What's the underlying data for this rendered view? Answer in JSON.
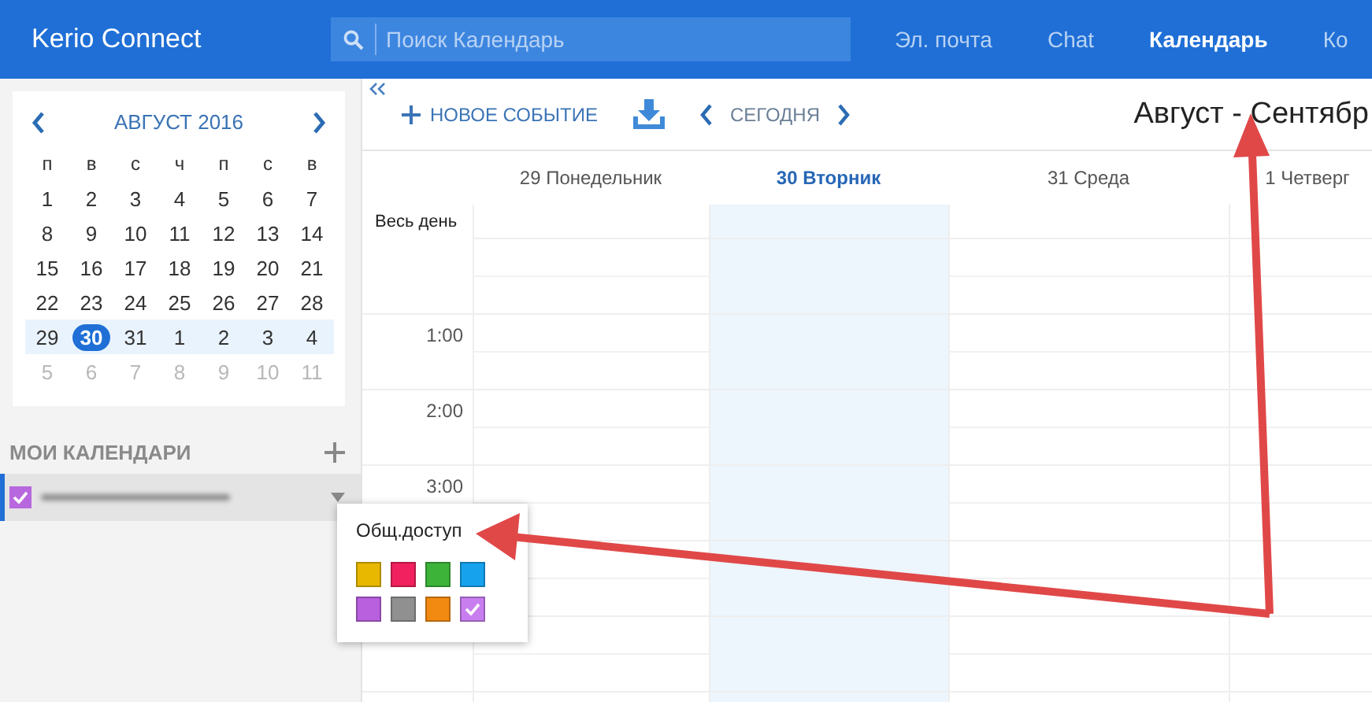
{
  "header": {
    "app_title": "Kerio Connect",
    "search": {
      "placeholder": "Поиск Календарь"
    },
    "nav": [
      {
        "label": "Эл. почта",
        "selected": false
      },
      {
        "label": "Chat",
        "selected": false
      },
      {
        "label": "Календарь",
        "selected": true
      },
      {
        "label": "Ко",
        "selected": false
      }
    ]
  },
  "mini_calendar": {
    "month": "АВГУСТ 2016",
    "weekdays": [
      "п",
      "в",
      "с",
      "ч",
      "п",
      "с",
      "в"
    ],
    "weeks": [
      {
        "current": false,
        "days": [
          {
            "label": "1",
            "muted": false,
            "selected": false
          },
          {
            "label": "2",
            "muted": false,
            "selected": false
          },
          {
            "label": "3",
            "muted": false,
            "selected": false
          },
          {
            "label": "4",
            "muted": false,
            "selected": false
          },
          {
            "label": "5",
            "muted": false,
            "selected": false
          },
          {
            "label": "6",
            "muted": false,
            "selected": false
          },
          {
            "label": "7",
            "muted": false,
            "selected": false
          }
        ]
      },
      {
        "current": false,
        "days": [
          {
            "label": "8",
            "muted": false,
            "selected": false
          },
          {
            "label": "9",
            "muted": false,
            "selected": false
          },
          {
            "label": "10",
            "muted": false,
            "selected": false
          },
          {
            "label": "11",
            "muted": false,
            "selected": false
          },
          {
            "label": "12",
            "muted": false,
            "selected": false
          },
          {
            "label": "13",
            "muted": false,
            "selected": false
          },
          {
            "label": "14",
            "muted": false,
            "selected": false
          }
        ]
      },
      {
        "current": false,
        "days": [
          {
            "label": "15",
            "muted": false,
            "selected": false
          },
          {
            "label": "16",
            "muted": false,
            "selected": false
          },
          {
            "label": "17",
            "muted": false,
            "selected": false
          },
          {
            "label": "18",
            "muted": false,
            "selected": false
          },
          {
            "label": "19",
            "muted": false,
            "selected": false
          },
          {
            "label": "20",
            "muted": false,
            "selected": false
          },
          {
            "label": "21",
            "muted": false,
            "selected": false
          }
        ]
      },
      {
        "current": false,
        "days": [
          {
            "label": "22",
            "muted": false,
            "selected": false
          },
          {
            "label": "23",
            "muted": false,
            "selected": false
          },
          {
            "label": "24",
            "muted": false,
            "selected": false
          },
          {
            "label": "25",
            "muted": false,
            "selected": false
          },
          {
            "label": "26",
            "muted": false,
            "selected": false
          },
          {
            "label": "27",
            "muted": false,
            "selected": false
          },
          {
            "label": "28",
            "muted": false,
            "selected": false
          }
        ]
      },
      {
        "current": true,
        "days": [
          {
            "label": "29",
            "muted": false,
            "selected": false
          },
          {
            "label": "30",
            "muted": false,
            "selected": true
          },
          {
            "label": "31",
            "muted": false,
            "selected": false
          },
          {
            "label": "1",
            "muted": false,
            "selected": false
          },
          {
            "label": "2",
            "muted": false,
            "selected": false
          },
          {
            "label": "3",
            "muted": false,
            "selected": false
          },
          {
            "label": "4",
            "muted": false,
            "selected": false
          }
        ]
      },
      {
        "current": false,
        "days": [
          {
            "label": "5",
            "muted": true,
            "selected": false
          },
          {
            "label": "6",
            "muted": true,
            "selected": false
          },
          {
            "label": "7",
            "muted": true,
            "selected": false
          },
          {
            "label": "8",
            "muted": true,
            "selected": false
          },
          {
            "label": "9",
            "muted": true,
            "selected": false
          },
          {
            "label": "10",
            "muted": true,
            "selected": false
          },
          {
            "label": "11",
            "muted": true,
            "selected": false
          }
        ]
      }
    ]
  },
  "my_calendars": {
    "heading": "МОИ КАЛЕНДАРИ",
    "calendars": [
      {
        "checked": true,
        "color": "#b868de",
        "selected": true
      }
    ]
  },
  "color_popup": {
    "title": "Общ.доступ",
    "swatches": [
      {
        "color": "#e8b800",
        "selected": false
      },
      {
        "color": "#f0215e",
        "selected": false
      },
      {
        "color": "#3db33a",
        "selected": false
      },
      {
        "color": "#17a2ee",
        "selected": false
      },
      {
        "color": "#b860de",
        "selected": false
      },
      {
        "color": "#909090",
        "selected": false
      },
      {
        "color": "#f28a12",
        "selected": false
      },
      {
        "color": "#c97ef0",
        "selected": true
      }
    ]
  },
  "toolbar": {
    "new_event": "НОВОЕ СОБЫТИЕ",
    "today": "СЕГОДНЯ",
    "range_title": "Август - Сентябр"
  },
  "week": {
    "days": [
      {
        "label": "29 Понедельник",
        "selected": false
      },
      {
        "label": "30 Вторник",
        "selected": true
      },
      {
        "label": "31 Среда",
        "selected": false
      },
      {
        "label": "1 Четверг",
        "selected": false
      }
    ],
    "all_day_label": "Весь день",
    "hour_labels": [
      "1:00",
      "2:00",
      "3:00"
    ]
  }
}
